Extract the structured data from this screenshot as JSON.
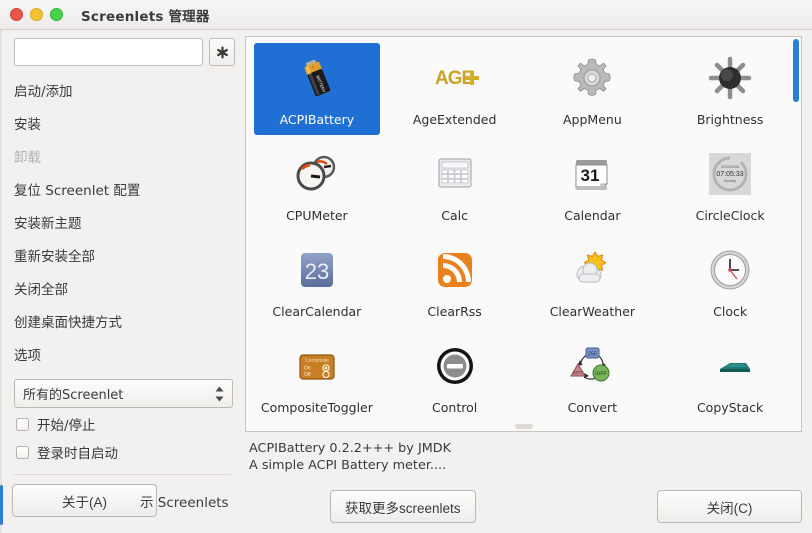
{
  "window": {
    "title": "Screenlets 管理器",
    "controls": {
      "close": "close-button",
      "minimize": "minimize-button",
      "maximize": "maximize-button"
    }
  },
  "sidebar": {
    "search": {
      "value": "",
      "placeholder": ""
    },
    "clear_icon": "clear-asterisk-icon",
    "menu": [
      {
        "label": "启动/添加",
        "disabled": false
      },
      {
        "label": "安装",
        "disabled": false
      },
      {
        "label": "卸载",
        "disabled": true
      },
      {
        "label": "复位 Screenlet 配置",
        "disabled": false
      },
      {
        "label": "安装新主题",
        "disabled": false
      },
      {
        "label": "重新安装全部",
        "disabled": false
      },
      {
        "label": "关闭全部",
        "disabled": false
      },
      {
        "label": "创建桌面快捷方式",
        "disabled": false
      },
      {
        "label": "选项",
        "disabled": false
      }
    ],
    "filter": {
      "selected": "所有的Screenlet"
    },
    "checkboxes": [
      {
        "label": "开始/停止",
        "checked": false
      },
      {
        "label": "登录时自启动",
        "checked": false
      }
    ],
    "about_label": "关于(A)",
    "occluded_label": "示 Screenlets"
  },
  "main": {
    "screenlets": [
      {
        "name": "ACPIBattery",
        "icon": "battery-icon",
        "selected": true
      },
      {
        "name": "AgeExtended",
        "icon": "age-plus-icon",
        "selected": false
      },
      {
        "name": "AppMenu",
        "icon": "gear-icon",
        "selected": false
      },
      {
        "name": "Brightness",
        "icon": "brightness-sun-icon",
        "selected": false
      },
      {
        "name": "CPUMeter",
        "icon": "dual-gauge-icon",
        "selected": false
      },
      {
        "name": "Calc",
        "icon": "calculator-icon",
        "selected": false
      },
      {
        "name": "Calendar",
        "icon": "calendar-31-icon",
        "selected": false
      },
      {
        "name": "CircleClock",
        "icon": "circle-clock-icon",
        "selected": false
      },
      {
        "name": "ClearCalendar",
        "icon": "calendar-23-icon",
        "selected": false
      },
      {
        "name": "ClearRss",
        "icon": "rss-icon",
        "selected": false
      },
      {
        "name": "ClearWeather",
        "icon": "sun-cloud-icon",
        "selected": false
      },
      {
        "name": "Clock",
        "icon": "analog-clock-icon",
        "selected": false
      },
      {
        "name": "CompositeToggler",
        "icon": "composite-toggle-icon",
        "selected": false
      },
      {
        "name": "Control",
        "icon": "minus-circle-icon",
        "selected": false
      },
      {
        "name": "Convert",
        "icon": "convert-cycle-icon",
        "selected": false
      },
      {
        "name": "CopyStack",
        "icon": "copy-stack-icon",
        "selected": false
      }
    ],
    "icon_text": {
      "age": "AGE",
      "calendar_day": "31",
      "clear_calendar_day": "23",
      "circleclock_date": "02/24/2008",
      "circleclock_time": "07:05:33",
      "circleclock_weekday": "Sunday",
      "composite_title": "Composite",
      "composite_on": "On",
      "composite_off": "Off",
      "convert_dec": "255",
      "convert_oct": "0377",
      "convert_hex": "0xFF"
    },
    "description_line1": "ACPIBattery 0.2.2+++ by JMDK",
    "description_line2": "A simple ACPI Battery meter...."
  },
  "footer": {
    "get_more_label": "获取更多screenlets",
    "close_label": "关闭(C)"
  },
  "colors": {
    "selection": "#1f6fd4",
    "scrollbar": "#2a7fd4",
    "window_bg": "#f2f1f0",
    "grid_bg": "#fafafa"
  }
}
